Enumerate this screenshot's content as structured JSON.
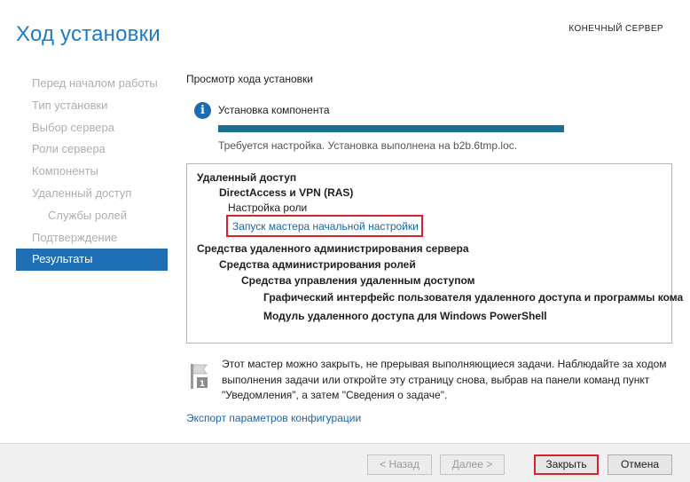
{
  "header": {
    "title": "Ход установки",
    "server_label": "КОНЕЧНЫЙ СЕРВЕР"
  },
  "sidebar": {
    "items": [
      {
        "label": "Перед началом работы"
      },
      {
        "label": "Тип установки"
      },
      {
        "label": "Выбор сервера"
      },
      {
        "label": "Роли сервера"
      },
      {
        "label": "Компоненты"
      },
      {
        "label": "Удаленный доступ"
      },
      {
        "label": "Службы ролей"
      },
      {
        "label": "Подтверждение"
      },
      {
        "label": "Результаты"
      }
    ],
    "active_index": 8
  },
  "main": {
    "section_title": "Просмотр хода установки",
    "status_text": "Установка компонента",
    "progress_percent": 100,
    "progress_color": "#1b6e8f",
    "progress_note": "Требуется настройка. Установка выполнена на b2b.6tmp.loc.",
    "results": {
      "line1": "Удаленный доступ",
      "line2": "DirectAccess и VPN (RAS)",
      "line3": "Настройка роли",
      "wizard_link": "Запуск мастера начальной настройки",
      "line5": "Средства удаленного администрирования сервера",
      "line6": "Средства администрирования ролей",
      "line7": "Средства управления удаленным доступом",
      "line8": "Графический интерфейс пользователя удаленного доступа и программы кома",
      "line9": "Модуль удаленного доступа для Windows PowerShell"
    },
    "note_lines": [
      "Этот мастер можно закрыть, не прерывая выполняющиеся задачи. Наблюдайте за ходом",
      "выполнения задачи или откройте эту страницу снова, выбрав на панели команд пункт",
      "\"Уведомления\", а затем \"Сведения о задаче\"."
    ],
    "export_link": "Экспорт параметров конфигурации"
  },
  "footer": {
    "back_label": "< Назад",
    "next_label": "Далее >",
    "close_label": "Закрыть",
    "cancel_label": "Отмена"
  },
  "colors": {
    "accent": "#1e7bc4",
    "highlight": "#d5232b"
  },
  "icons": {
    "info": "info-icon",
    "note": "flag-note-icon"
  }
}
